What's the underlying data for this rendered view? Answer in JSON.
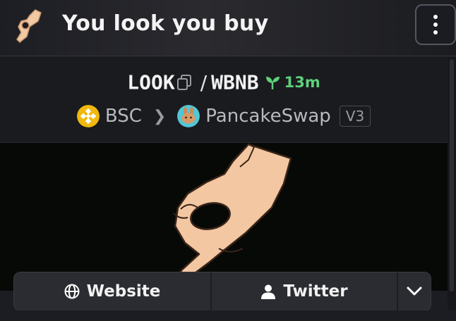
{
  "header": {
    "title": "You look you buy",
    "logo_icon": "ok-hand-icon",
    "menu_icon": "vertical-dots-icon"
  },
  "pair": {
    "base": "LOOK",
    "separator": "/",
    "quote": "WBNB",
    "age": "13m",
    "copy_icon": "copy-icon",
    "age_icon": "sprout-icon"
  },
  "chain": {
    "network": "BSC",
    "dex": "PancakeSwap",
    "version": "V3",
    "network_icon": "bnb-icon",
    "dex_icon": "pancakeswap-icon"
  },
  "links": {
    "website": "Website",
    "twitter": "Twitter"
  },
  "colors": {
    "accent_green": "#5fd07a",
    "bnb_yellow": "#f0b90b",
    "pancake_teal": "#53c6d6",
    "banner_bg": "#060906",
    "skin": "#f2c9a5"
  }
}
